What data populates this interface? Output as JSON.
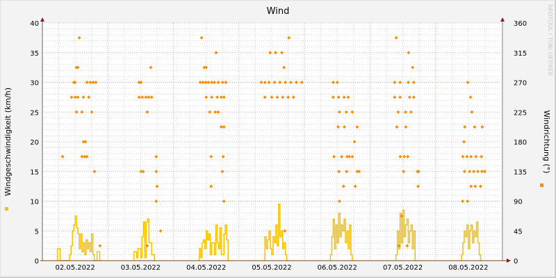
{
  "chart_data": {
    "type": "line+scatter",
    "title": "Wind",
    "ylabel": "Windgeschwindigkeit (km/h)",
    "y2label": "Windrichtung (°)",
    "ylim": [
      0,
      40
    ],
    "y2lim": [
      0,
      360
    ],
    "yticks": [
      "0",
      "5",
      "10",
      "15",
      "20",
      "25",
      "30",
      "35",
      "40"
    ],
    "y2ticks": [
      "0",
      "45",
      "90",
      "135",
      "180",
      "225",
      "270",
      "315",
      "360"
    ],
    "xlim_hours": [
      0,
      168
    ],
    "xtick_labels": [
      "02.05.2022",
      "03.05.2022",
      "04.05.2022",
      "05.05.2022",
      "06.05.2022",
      "07.05.2022",
      "08.05.2022"
    ],
    "grid": true,
    "watermark": "RRDTOOL / TOBI OETIKER",
    "series": [
      {
        "name": "Windgeschwindigkeit",
        "type": "step-line",
        "axis": "left",
        "color": "#f5bf00",
        "step_hours": 0.5,
        "segments": [
          {
            "start_hour": 5.5,
            "values": [
              2,
              2,
              0,
              0,
              0,
              0,
              0,
              0,
              0,
              1,
              2.5,
              5,
              6,
              7.5,
              5.5,
              4.5,
              2,
              4.5,
              1.5,
              3,
              1,
              3.5,
              2,
              3,
              1.5,
              4.5,
              1,
              0,
              0,
              1.5,
              1.5,
              0
            ]
          },
          {
            "start_hour": 33.5,
            "values": [
              1.5,
              1.5,
              0.5,
              2,
              2,
              0.5,
              4,
              6.5,
              0.5,
              6.5,
              7,
              3,
              3,
              1,
              1,
              0
            ]
          },
          {
            "start_hour": 57.5,
            "values": [
              2,
              0.5,
              3,
              3.5,
              2,
              5,
              3.5,
              4.5,
              1,
              3,
              3,
              1,
              6,
              3,
              2,
              5.5,
              1,
              1,
              4.5,
              6,
              3.5,
              0
            ]
          },
          {
            "start_hour": 81.5,
            "values": [
              4,
              2,
              3.5,
              5,
              2,
              1,
              4,
              3,
              6,
              2.5,
              9.5,
              4,
              5,
              2,
              3,
              1,
              0
            ]
          },
          {
            "start_hour": 105.5,
            "values": [
              1,
              4,
              7,
              2,
              6,
              3,
              8,
              4,
              6,
              5,
              7,
              3,
              5,
              2,
              6,
              1,
              0
            ]
          },
          {
            "start_hour": 129.5,
            "values": [
              1,
              5,
              2,
              8,
              3,
              8.5,
              4,
              6,
              7,
              3,
              5,
              6,
              2,
              5,
              0
            ]
          },
          {
            "start_hour": 153.5,
            "values": [
              1,
              3,
              5,
              4,
              6,
              2,
              5,
              6,
              3,
              5,
              4,
              6.5,
              3,
              1,
              0
            ]
          }
        ]
      },
      {
        "name": "Windrichtung",
        "type": "scatter",
        "axis": "right",
        "color": "#ff8c00",
        "points": [
          [
            7.4,
            157.5
          ],
          [
            10.7,
            247.5
          ],
          [
            11.5,
            270
          ],
          [
            12,
            270
          ],
          [
            12.5,
            292.5
          ],
          [
            13,
            292.5
          ],
          [
            13.5,
            337.5
          ],
          [
            12,
            247.5
          ],
          [
            13,
            247.5
          ],
          [
            12.5,
            225
          ],
          [
            14.5,
            225
          ],
          [
            15,
            247.5
          ],
          [
            14.5,
            157.5
          ],
          [
            15,
            180
          ],
          [
            15.8,
            180
          ],
          [
            15.5,
            157.5
          ],
          [
            16.3,
            157.5
          ],
          [
            16.3,
            270
          ],
          [
            17,
            247.5
          ],
          [
            17.6,
            270
          ],
          [
            18.6,
            270
          ],
          [
            19.6,
            270
          ],
          [
            18.1,
            225
          ],
          [
            19.1,
            135
          ],
          [
            21.1,
            22.5
          ],
          [
            35.4,
            270
          ],
          [
            36.1,
            270
          ],
          [
            35.4,
            247.5
          ],
          [
            36.6,
            247.5
          ],
          [
            37.9,
            247.5
          ],
          [
            38.9,
            247.5
          ],
          [
            40,
            247.5
          ],
          [
            38.4,
            225
          ],
          [
            39.7,
            292.5
          ],
          [
            36.1,
            135
          ],
          [
            36.9,
            135
          ],
          [
            38.4,
            22.5
          ],
          [
            41.7,
            157.5
          ],
          [
            41.7,
            135
          ],
          [
            42,
            112.5
          ],
          [
            41.7,
            90
          ],
          [
            43.3,
            45
          ],
          [
            58.3,
            337.5
          ],
          [
            59.3,
            292.5
          ],
          [
            60,
            292.5
          ],
          [
            57.8,
            270
          ],
          [
            58.8,
            270
          ],
          [
            59.8,
            270
          ],
          [
            60.8,
            270
          ],
          [
            62,
            270
          ],
          [
            63,
            270
          ],
          [
            64.4,
            270
          ],
          [
            66,
            270
          ],
          [
            67.2,
            270
          ],
          [
            60,
            247.5
          ],
          [
            62,
            247.5
          ],
          [
            64,
            247.5
          ],
          [
            65.5,
            247.5
          ],
          [
            66.5,
            247.5
          ],
          [
            61.3,
            225
          ],
          [
            63.3,
            225
          ],
          [
            64.4,
            225
          ],
          [
            63.6,
            315
          ],
          [
            61.8,
            112.5
          ],
          [
            61.8,
            157.5
          ],
          [
            65.5,
            202.5
          ],
          [
            66.5,
            202.5
          ],
          [
            66.2,
            157.5
          ],
          [
            65.9,
            135
          ],
          [
            66.5,
            90
          ],
          [
            80.2,
            270
          ],
          [
            81.5,
            270
          ],
          [
            83,
            270
          ],
          [
            85,
            270
          ],
          [
            87,
            270
          ],
          [
            89,
            270
          ],
          [
            91,
            270
          ],
          [
            93,
            270
          ],
          [
            95,
            270
          ],
          [
            81.5,
            247.5
          ],
          [
            84,
            247.5
          ],
          [
            86,
            247.5
          ],
          [
            88,
            247.5
          ],
          [
            90,
            247.5
          ],
          [
            92,
            247.5
          ],
          [
            83.4,
            315
          ],
          [
            85.4,
            315
          ],
          [
            87.7,
            315
          ],
          [
            88.5,
            292.5
          ],
          [
            90.3,
            337.5
          ],
          [
            88.8,
            45
          ],
          [
            106.5,
            270
          ],
          [
            108,
            270
          ],
          [
            106.5,
            247.5
          ],
          [
            108.5,
            247.5
          ],
          [
            110.5,
            247.5
          ],
          [
            112,
            247.5
          ],
          [
            108.8,
            225
          ],
          [
            111.3,
            225
          ],
          [
            113.5,
            225
          ],
          [
            108.3,
            202.5
          ],
          [
            110.6,
            202.5
          ],
          [
            115.3,
            202.5
          ],
          [
            106.8,
            157.5
          ],
          [
            109.6,
            157.5
          ],
          [
            111.6,
            157.5
          ],
          [
            112.4,
            157.5
          ],
          [
            108.6,
            135
          ],
          [
            111.4,
            135
          ],
          [
            115.3,
            135
          ],
          [
            116,
            135
          ],
          [
            114.3,
            180
          ],
          [
            113.5,
            157.5
          ],
          [
            110.3,
            112.5
          ],
          [
            114.6,
            112.5
          ],
          [
            108.8,
            90
          ],
          [
            129.6,
            337.5
          ],
          [
            134.1,
            315
          ],
          [
            135.6,
            292.5
          ],
          [
            129,
            270
          ],
          [
            131,
            270
          ],
          [
            134,
            270
          ],
          [
            136,
            270
          ],
          [
            129,
            247.5
          ],
          [
            131,
            247.5
          ],
          [
            134.5,
            247.5
          ],
          [
            136,
            247.5
          ],
          [
            130.3,
            225
          ],
          [
            133,
            225
          ],
          [
            135,
            225
          ],
          [
            129.8,
            202.5
          ],
          [
            133.1,
            202.5
          ],
          [
            131.1,
            157.5
          ],
          [
            132.5,
            157.5
          ],
          [
            133.8,
            157.5
          ],
          [
            132.3,
            135
          ],
          [
            137.4,
            135
          ],
          [
            137.8,
            135
          ],
          [
            137.6,
            112.5
          ],
          [
            131.6,
            67.5
          ],
          [
            130.6,
            22.5
          ],
          [
            133.6,
            22.5
          ],
          [
            155.8,
            270
          ],
          [
            156.8,
            247.5
          ],
          [
            157.3,
            225
          ],
          [
            154.7,
            202.5
          ],
          [
            158.3,
            202.5
          ],
          [
            161.1,
            202.5
          ],
          [
            154.4,
            180
          ],
          [
            154,
            157.5
          ],
          [
            155.5,
            157.5
          ],
          [
            157,
            157.5
          ],
          [
            158.8,
            157.5
          ],
          [
            160.8,
            157.5
          ],
          [
            154.6,
            135
          ],
          [
            156.5,
            135
          ],
          [
            158,
            135
          ],
          [
            159.5,
            135
          ],
          [
            161,
            135
          ],
          [
            162,
            135
          ],
          [
            157,
            112.5
          ],
          [
            158.5,
            112.5
          ],
          [
            160.5,
            112.5
          ],
          [
            153.9,
            90
          ],
          [
            155.7,
            90
          ]
        ]
      }
    ],
    "legend": [
      {
        "series": "Windgeschwindigkeit",
        "color": "#f5bf00",
        "placement": "left"
      },
      {
        "series": "Windrichtung",
        "color": "#ff8c00",
        "placement": "right"
      }
    ]
  }
}
